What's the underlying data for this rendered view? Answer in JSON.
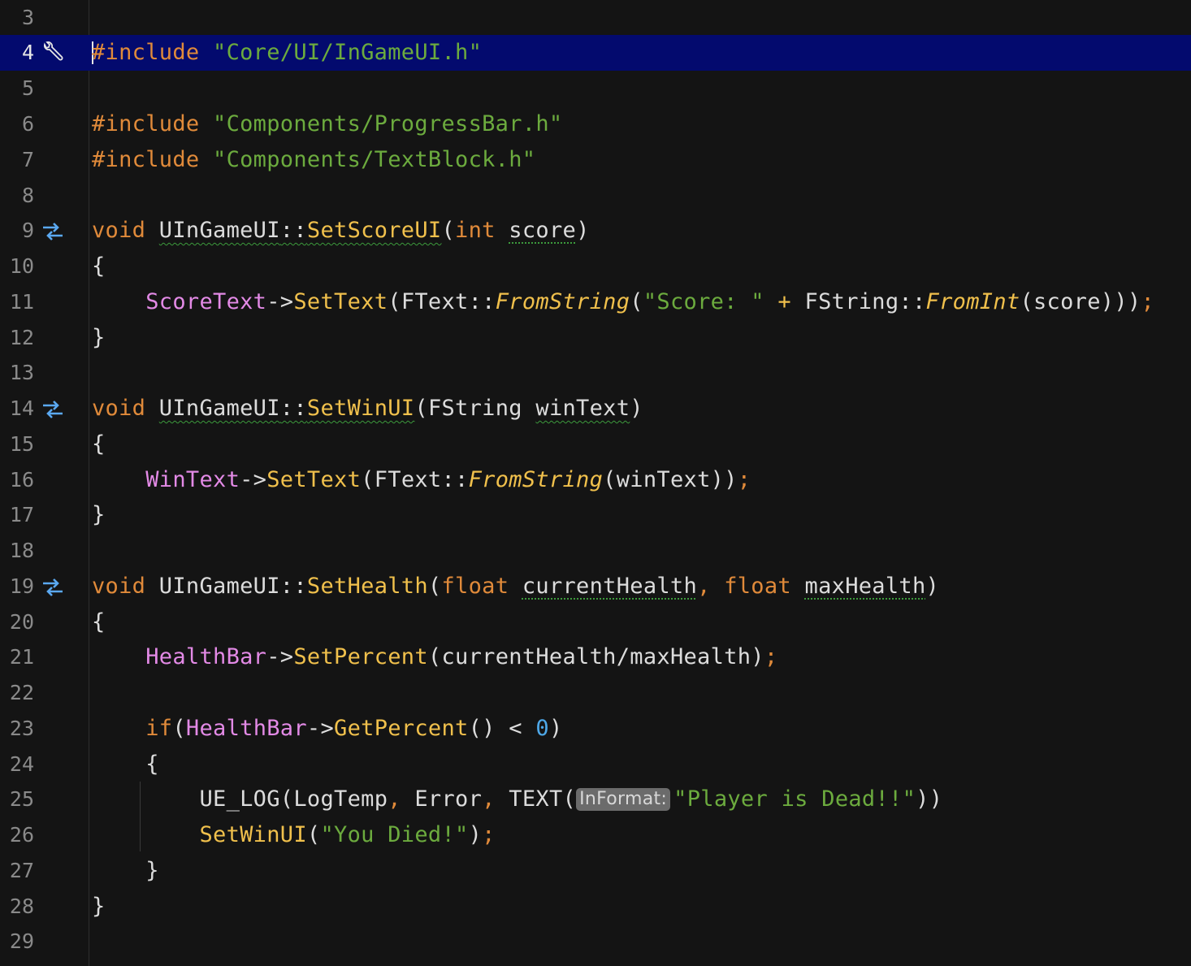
{
  "editor": {
    "line_numbers": [
      "3",
      "4",
      "5",
      "6",
      "7",
      "8",
      "9",
      "10",
      "11",
      "12",
      "13",
      "14",
      "15",
      "16",
      "17",
      "18",
      "19",
      "20",
      "21",
      "22",
      "23",
      "24",
      "25",
      "26",
      "27",
      "28",
      "29"
    ],
    "current_line": "4",
    "gutter_icons": {
      "line4": "wrench-icon",
      "line9": "swap-arrows-icon",
      "line14": "swap-arrows-icon",
      "line19": "swap-arrows-icon"
    },
    "tokens": {
      "include_kw": "#include",
      "inc1": "\"Core/UI/InGameUI.h\"",
      "inc2": "\"Components/ProgressBar.h\"",
      "inc3": "\"Components/TextBlock.h\"",
      "void": "void",
      "cls": "UInGameUI",
      "scope": "::",
      "fn_setscore": "SetScoreUI",
      "int": "int",
      "score": "score",
      "lbrace": "{",
      "rbrace": "}",
      "scoretext": "ScoreText",
      "arrow": "->",
      "settext": "SetText",
      "ftext": "FText",
      "fromstring": "FromString",
      "score_str": "\"Score: \"",
      "plus": "+",
      "fstring": "FString",
      "fromint": "FromInt",
      "fn_setwin": "SetWinUI",
      "wintext_param": "winText",
      "wintext_field": "WinText",
      "fn_sethealth": "SetHealth",
      "float": "float",
      "currenthealth": "currentHealth",
      "maxhealth": "maxHealth",
      "healthbar": "HealthBar",
      "setpercent": "SetPercent",
      "if": "if",
      "getpercent": "GetPercent",
      "zero": "0",
      "ue_log": "UE_LOG",
      "logtemp": "LogTemp",
      "error": "Error",
      "text_macro": "TEXT",
      "hint_informat": "InFormat:",
      "dead_str": "\"Player is Dead!!\"",
      "died_str": "\"You Died!\""
    }
  },
  "colors": {
    "background": "#141414",
    "current_line": "#030a6e",
    "keyword": "#e08a3a",
    "string": "#6cab3e",
    "function": "#f0c04c",
    "field": "#e38ae6",
    "number": "#4ea8e8"
  }
}
